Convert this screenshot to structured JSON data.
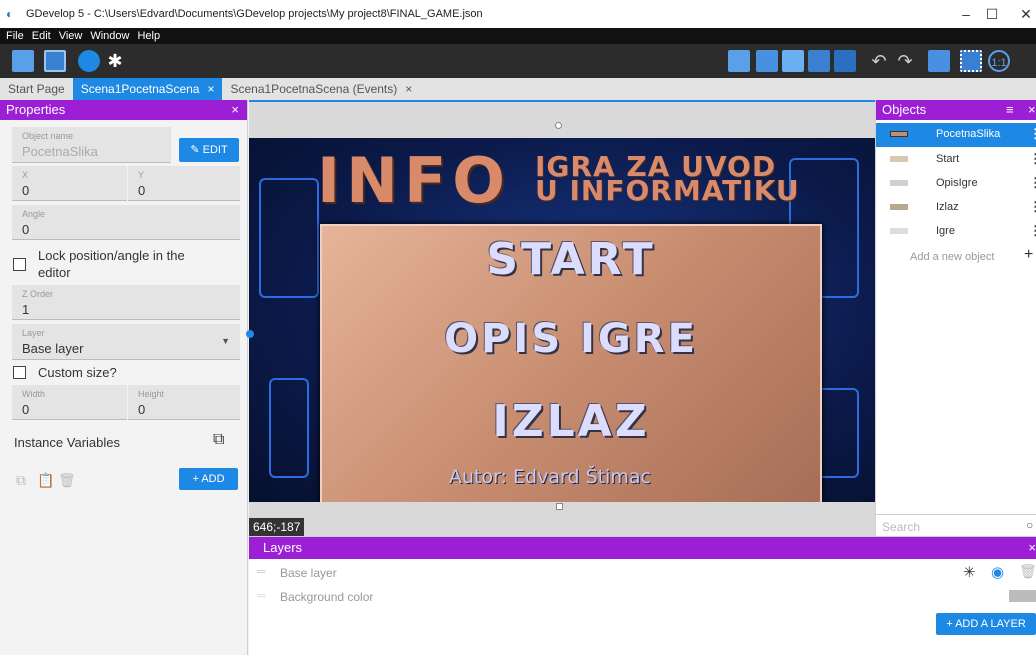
{
  "window": {
    "title": "GDevelop 5 - C:\\Users\\Edvard\\Documents\\GDevelop projects\\My project8\\FINAL_GAME.json",
    "minimize": "–",
    "maximize": "☐",
    "close": "✕"
  },
  "menu": [
    "File",
    "Edit",
    "View",
    "Window",
    "Help"
  ],
  "tabs": [
    {
      "label": "Start Page",
      "close": ""
    },
    {
      "label": "Scena1PocetnaScena",
      "close": "×"
    },
    {
      "label": "Scena1PocetnaScena (Events)",
      "close": "×"
    }
  ],
  "properties": {
    "header": "Properties",
    "close": "×",
    "object_name_label": "Object name",
    "object_name": "PocetnaSlika",
    "edit_label": "EDIT",
    "x_label": "X",
    "x": "0",
    "y_label": "Y",
    "y": "0",
    "angle_label": "Angle",
    "angle": "0",
    "lock_label_1": "Lock position/angle in the",
    "lock_label_2": "editor",
    "z_order_label": "Z Order",
    "z_order": "1",
    "layer_label": "Layer",
    "layer": "Base layer",
    "custom_size_label": "Custom size?",
    "width_label": "Width",
    "width": "0",
    "height_label": "Height",
    "height": "0",
    "instance_vars_label": "Instance Variables",
    "add_label": "ADD"
  },
  "game": {
    "info_big": "INFO",
    "info_line1": "IGRA ZA UVOD",
    "info_line2": "U INFORMATIKU",
    "start": "START",
    "opis": "OPIS IGRE",
    "izlaz": "IZLAZ",
    "author": "Autor: Edvard Štimac"
  },
  "canvas": {
    "coords": "646;-187"
  },
  "objects": {
    "header": "Objects",
    "items": [
      {
        "name": "PocetnaSlika",
        "selected": true
      },
      {
        "name": "Start",
        "selected": false
      },
      {
        "name": "OpisIgre",
        "selected": false
      },
      {
        "name": "Izlaz",
        "selected": false
      },
      {
        "name": "Igre",
        "selected": false
      }
    ],
    "add_new": "Add a new object",
    "search_placeholder": "Search"
  },
  "layers": {
    "header": "Layers",
    "close": "×",
    "base_layer": "Base layer",
    "background": "Background color",
    "add_layer": "ADD A LAYER"
  },
  "colors": {
    "accent_blue": "#1e88e5",
    "panel_purple": "#9c1fd6"
  }
}
